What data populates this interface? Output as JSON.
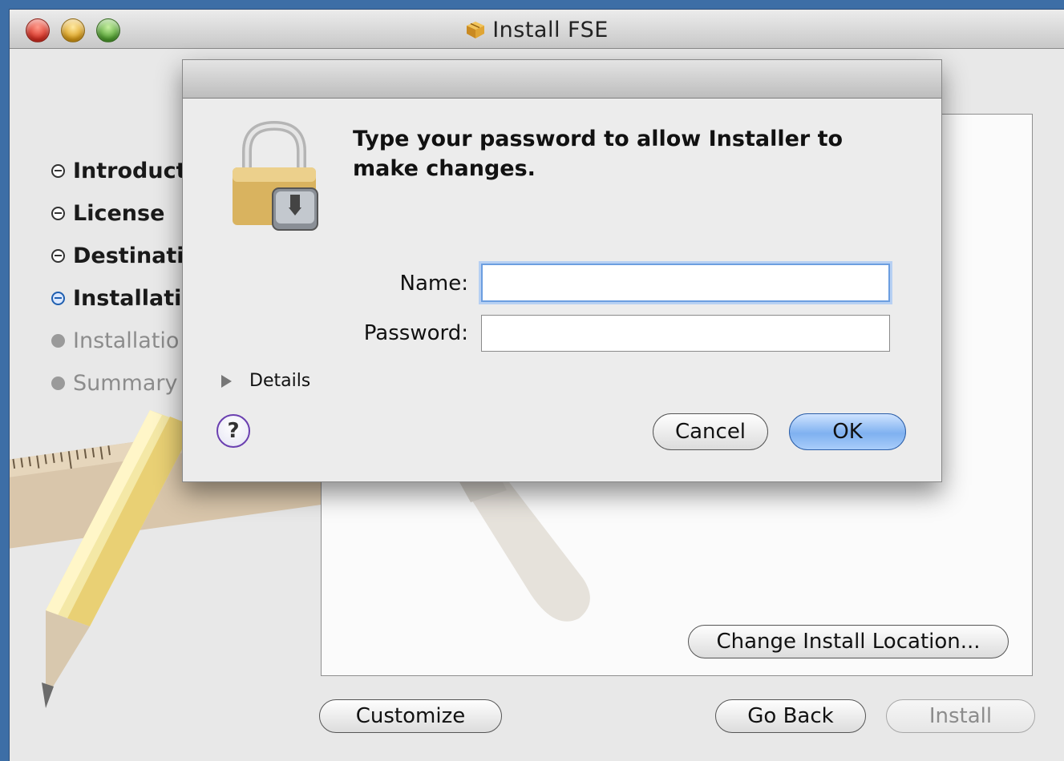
{
  "window": {
    "title": "Install FSE"
  },
  "sidebar": {
    "steps": [
      {
        "label": "Introduct",
        "state": "done"
      },
      {
        "label": "License",
        "state": "done"
      },
      {
        "label": "Destinati",
        "state": "done"
      },
      {
        "label": "Installatio",
        "state": "current"
      },
      {
        "label": "Installatio",
        "state": "todo"
      },
      {
        "label": "Summary",
        "state": "todo"
      }
    ]
  },
  "main": {
    "change_location_label": "Change Install Location..."
  },
  "footer": {
    "customize_label": "Customize",
    "go_back_label": "Go Back",
    "install_label": "Install"
  },
  "auth_dialog": {
    "prompt": "Type your password to allow Installer to make changes.",
    "name_label": "Name:",
    "name_value": "",
    "password_label": "Password:",
    "password_value": "",
    "details_label": "Details",
    "help_label": "?",
    "cancel_label": "Cancel",
    "ok_label": "OK"
  },
  "colors": {
    "desktop": "#3d6ea6",
    "default_button": "#7fb1f0",
    "current_step": "#1f5fb0",
    "help_ring": "#6a3fb0"
  }
}
